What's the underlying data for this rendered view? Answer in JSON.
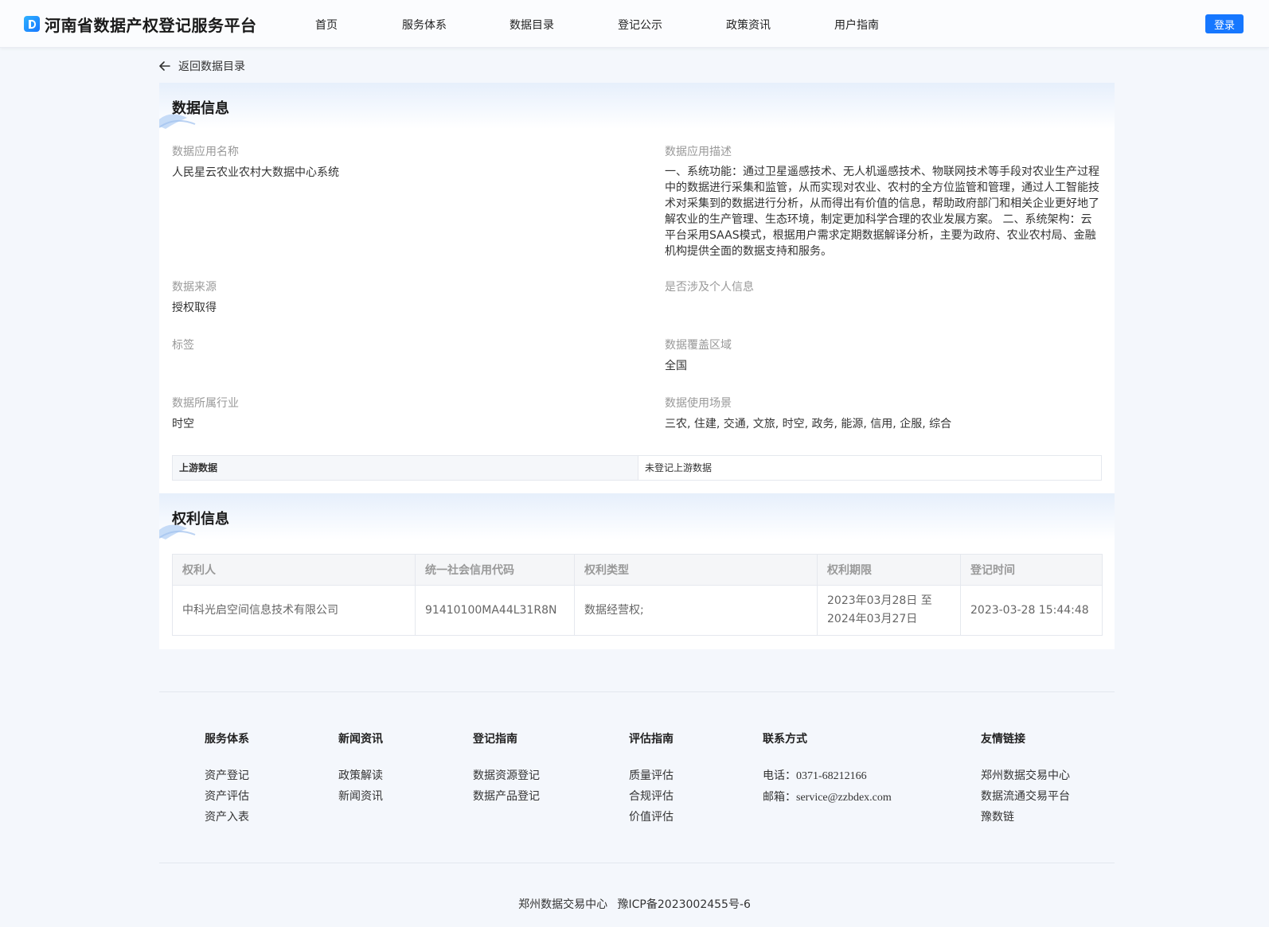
{
  "header": {
    "title": "河南省数据产权登记服务平台",
    "nav": [
      "首页",
      "服务体系",
      "数据目录",
      "登记公示",
      "政策资讯",
      "用户指南"
    ],
    "login_label": "登录"
  },
  "back_label": "返回数据目录",
  "data_info": {
    "section_title": "数据信息",
    "app_name_label": "数据应用名称",
    "app_name": "人民星云农业农村大数据中心系统",
    "desc_label": "数据应用描述",
    "desc": "一、系统功能：通过卫星遥感技术、无人机遥感技术、物联网技术等手段对农业生产过程中的数据进行采集和监管，从而实现对农业、农村的全方位监管和管理，通过人工智能技术对采集到的数据进行分析，从而得出有价值的信息，帮助政府部门和相关企业更好地了解农业的生产管理、生态环境，制定更加科学合理的农业发展方案。 二、系统架构：云平台采用SAAS模式，根据用户需求定期数据解译分析，主要为政府、农业农村局、金融机构提供全面的数据支持和服务。",
    "source_label": "数据来源",
    "source": "授权取得",
    "personal_label": "是否涉及个人信息",
    "personal": "",
    "tags_label": "标签",
    "tags": "",
    "coverage_label": "数据覆盖区域",
    "coverage": "全国",
    "industry_label": "数据所属行业",
    "industry": "时空",
    "scenario_label": "数据使用场景",
    "scenario": "三农, 住建, 交通, 文旅, 时空, 政务, 能源, 信用, 企服, 综合",
    "upstream_label": "上游数据",
    "upstream_value": "未登记上游数据"
  },
  "rights_info": {
    "section_title": "权利信息",
    "columns": [
      "权利人",
      "统一社会信用代码",
      "权利类型",
      "权利期限",
      "登记时间"
    ],
    "rows": [
      {
        "holder": "中科光启空间信息技术有限公司",
        "credit_code": "91410100MA44L31R8N",
        "right_type": "数据经营权;",
        "period_start": "2023年03月28日 至",
        "period_end": "2024年03月27日",
        "reg_time": "2023-03-28 15:44:48"
      }
    ]
  },
  "footer": {
    "service": {
      "title": "服务体系",
      "links": [
        "资产登记",
        "资产评估",
        "资产入表"
      ]
    },
    "news": {
      "title": "新闻资讯",
      "links": [
        "政策解读",
        "新闻资讯"
      ]
    },
    "reg_guide": {
      "title": "登记指南",
      "links": [
        "数据资源登记",
        "数据产品登记"
      ]
    },
    "eval_guide": {
      "title": "评估指南",
      "links": [
        "质量评估",
        "合规评估",
        "价值评估"
      ]
    },
    "contact": {
      "title": "联系方式",
      "phone_label": "电话：",
      "phone": "0371-68212166",
      "email_label": "邮箱：",
      "email": "service@zzbdex.com"
    },
    "friends": {
      "title": "友情链接",
      "links": [
        "郑州数据交易中心",
        "数据流通交易平台",
        "豫数链"
      ]
    },
    "org": "郑州数据交易中心",
    "icp": "豫ICP备2023002455号-6"
  },
  "colors": {
    "primary": "#1677ff",
    "page_bg": "#f4f7fc"
  }
}
